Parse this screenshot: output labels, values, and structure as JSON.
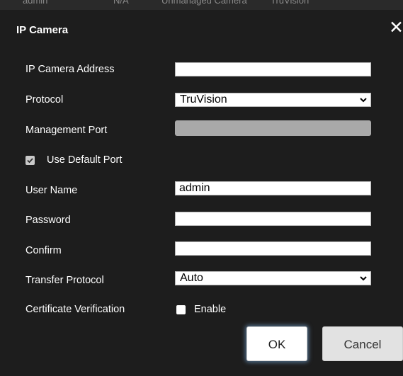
{
  "background_tabs": [
    "admin",
    "N/A",
    "Unmanaged Camera",
    "TruVision"
  ],
  "dialog": {
    "title": "IP Camera",
    "close_icon": "close-icon"
  },
  "form": {
    "ip_address": {
      "label": "IP Camera Address",
      "value": ""
    },
    "protocol": {
      "label": "Protocol",
      "value": "TruVision"
    },
    "management_port": {
      "label": "Management Port",
      "value": "",
      "disabled": true
    },
    "use_default_port": {
      "label": "Use Default Port",
      "checked": true
    },
    "user_name": {
      "label": "User Name",
      "value": "admin"
    },
    "password": {
      "label": "Password",
      "value": ""
    },
    "confirm": {
      "label": "Confirm",
      "value": ""
    },
    "transfer_protocol": {
      "label": "Transfer Protocol",
      "value": "Auto"
    },
    "certificate_verification": {
      "label": "Certificate Verification",
      "enable_label": "Enable",
      "checked": false
    }
  },
  "buttons": {
    "ok": "OK",
    "cancel": "Cancel"
  }
}
